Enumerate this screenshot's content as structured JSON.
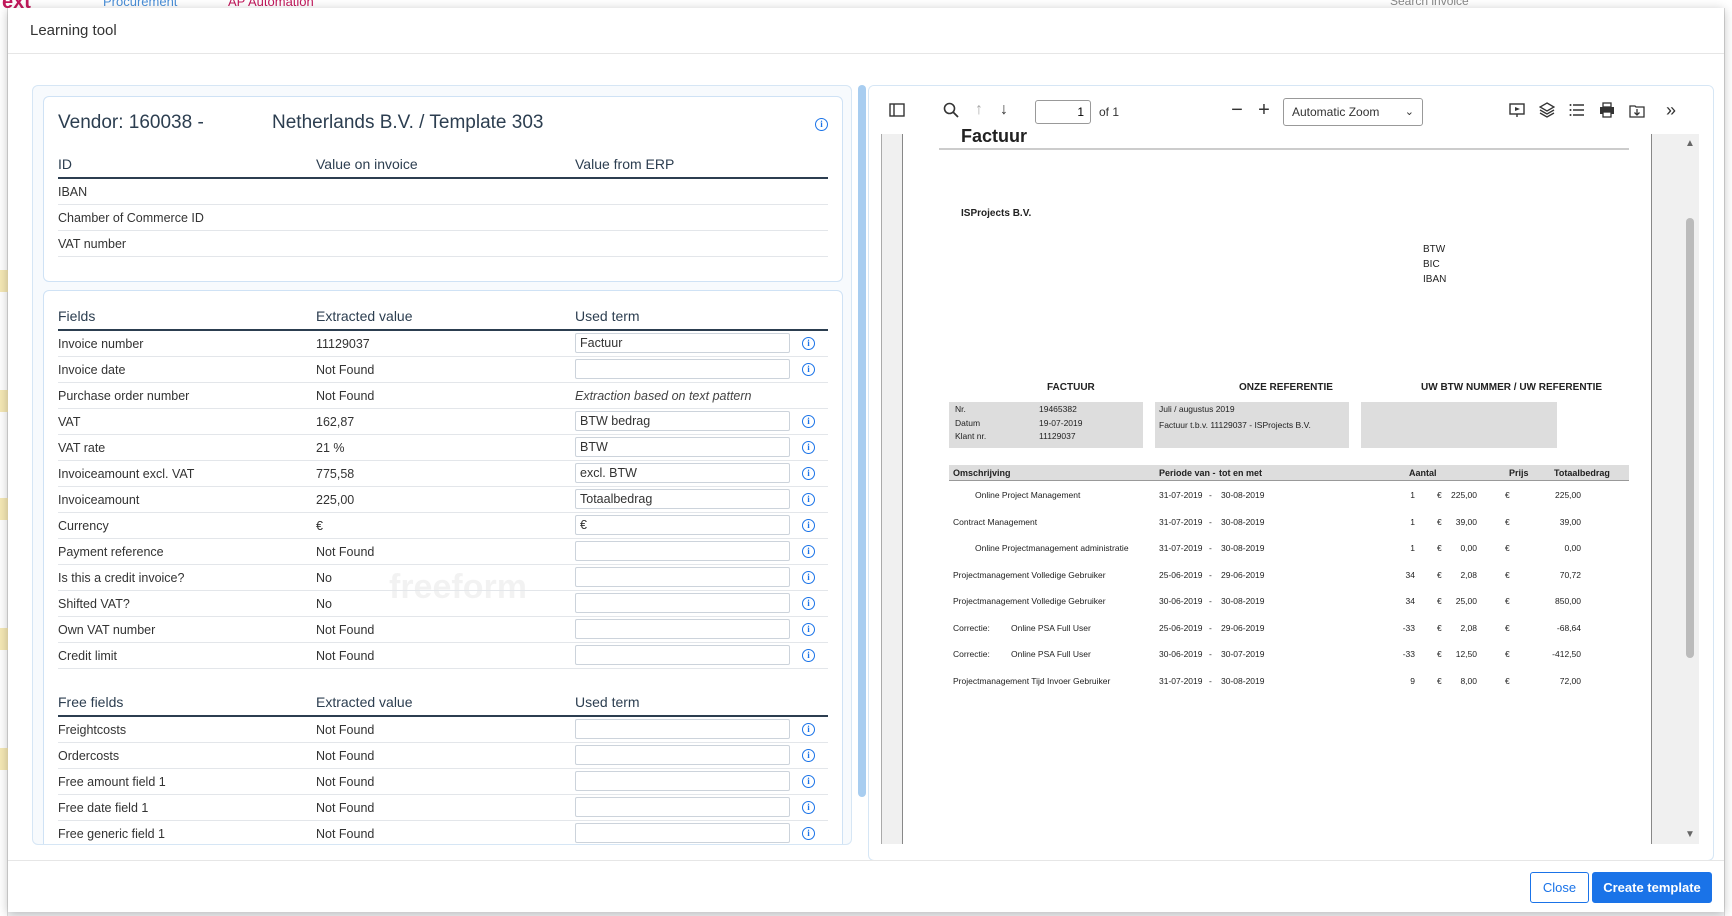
{
  "background": {
    "logo": "ext",
    "nav": [
      "Procurement",
      "AP Automation"
    ],
    "search_placeholder": "Search invoice"
  },
  "modal": {
    "title": "Learning tool",
    "close_label": "Close",
    "create_label": "Create template"
  },
  "vendor": {
    "title_part1": "Vendor: 160038 -",
    "title_part2": "Netherlands B.V. / Template 303",
    "headers": [
      "ID",
      "Value on invoice",
      "Value from ERP"
    ],
    "rows": [
      "IBAN",
      "Chamber of Commerce ID",
      "VAT number"
    ]
  },
  "fields": {
    "headers": [
      "Fields",
      "Extracted value",
      "Used term"
    ],
    "rows": [
      {
        "label": "Invoice number",
        "value": "11129037",
        "term": "Factuur"
      },
      {
        "label": "Invoice date",
        "value": "Not Found",
        "term": ""
      },
      {
        "label": "Purchase order number",
        "value": "Not Found",
        "term_text": "Extraction based on text pattern"
      },
      {
        "label": "VAT",
        "value": "162,87",
        "term": "BTW bedrag"
      },
      {
        "label": "VAT rate",
        "value": "21 %",
        "term": "BTW"
      },
      {
        "label": "Invoiceamount excl. VAT",
        "value": "775,58",
        "term": "excl. BTW"
      },
      {
        "label": "Invoiceamount",
        "value": "225,00",
        "term": "Totaalbedrag"
      },
      {
        "label": "Currency",
        "value": "€",
        "term": "€"
      },
      {
        "label": "Payment reference",
        "value": "Not Found",
        "term": ""
      },
      {
        "label": "Is this a credit invoice?",
        "value": "No",
        "term": ""
      },
      {
        "label": "Shifted VAT?",
        "value": "No",
        "term": ""
      },
      {
        "label": "Own VAT number",
        "value": "Not Found",
        "term": ""
      },
      {
        "label": "Credit limit",
        "value": "Not Found",
        "term": ""
      }
    ],
    "watermark": "freeform"
  },
  "free_fields": {
    "headers": [
      "Free fields",
      "Extracted value",
      "Used term"
    ],
    "rows": [
      {
        "label": "Freightcosts",
        "value": "Not Found",
        "term": ""
      },
      {
        "label": "Ordercosts",
        "value": "Not Found",
        "term": ""
      },
      {
        "label": "Free amount field 1",
        "value": "Not Found",
        "term": ""
      },
      {
        "label": "Free date field 1",
        "value": "Not Found",
        "term": ""
      },
      {
        "label": "Free generic field 1",
        "value": "Not Found",
        "term": ""
      }
    ]
  },
  "pdf_toolbar": {
    "page": "1",
    "page_of": "of 1",
    "zoom": "Automatic Zoom"
  },
  "document": {
    "heading_cut": "Factuur",
    "company": "ISProjects B.V.",
    "bank_labels": [
      "BTW",
      "BIC",
      "IBAN"
    ],
    "section_headers": [
      "FACTUUR",
      "ONZE REFERENTIE",
      "UW BTW NUMMER / UW REFERENTIE"
    ],
    "factuur_box": [
      {
        "k": "Nr.",
        "v": "19465382"
      },
      {
        "k": "Datum",
        "v": "19-07-2019"
      },
      {
        "k": "Klant nr.",
        "v": "11129037"
      }
    ],
    "referentie": [
      "Juli / augustus 2019",
      "Factuur t.b.v. 11129037 - ISProjects B.V."
    ],
    "table_headers": [
      "Omschrijving",
      "Periode van  -",
      "tot en met",
      "Aantal",
      "Prijs",
      "Totaalbedrag"
    ],
    "lines": [
      {
        "prefix": "",
        "desc": "Online Project Management",
        "indent": true,
        "from": "31-07-2019",
        "to": "30-08-2019",
        "qty": "1",
        "price": "225,00",
        "total": "225,00"
      },
      {
        "prefix": "",
        "desc": "Contract Management",
        "indent": false,
        "from": "31-07-2019",
        "to": "30-08-2019",
        "qty": "1",
        "price": "39,00",
        "total": "39,00"
      },
      {
        "prefix": "",
        "desc": "Online Projectmanagement administratie",
        "indent": true,
        "from": "31-07-2019",
        "to": "30-08-2019",
        "qty": "1",
        "price": "0,00",
        "total": "0,00"
      },
      {
        "prefix": "",
        "desc": "Projectmanagement Volledige Gebruiker",
        "indent": false,
        "from": "25-06-2019",
        "to": "29-06-2019",
        "qty": "34",
        "price": "2,08",
        "total": "70,72"
      },
      {
        "prefix": "",
        "desc": "Projectmanagement Volledige Gebruiker",
        "indent": false,
        "from": "30-06-2019",
        "to": "30-08-2019",
        "qty": "34",
        "price": "25,00",
        "total": "850,00"
      },
      {
        "prefix": "Correctie:",
        "desc": "Online PSA Full User",
        "indent": false,
        "from": "25-06-2019",
        "to": "29-06-2019",
        "qty": "-33",
        "price": "2,08",
        "total": "-68,64"
      },
      {
        "prefix": "Correctie:",
        "desc": "Online PSA Full User",
        "indent": false,
        "from": "30-06-2019",
        "to": "30-07-2019",
        "qty": "-33",
        "price": "12,50",
        "total": "-412,50"
      },
      {
        "prefix": "",
        "desc": "Projectmanagement Tijd Invoer Gebruiker",
        "indent": false,
        "from": "31-07-2019",
        "to": "30-08-2019",
        "qty": "9",
        "price": "8,00",
        "total": "72,00"
      }
    ],
    "currency": "€",
    "dash": "-"
  }
}
